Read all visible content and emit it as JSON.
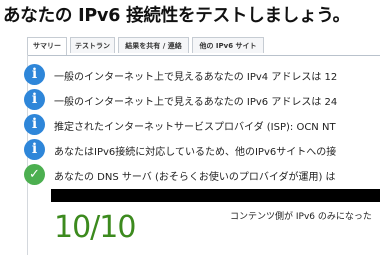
{
  "page": {
    "title": "あなたの IPv6 接続性をテストしましょう。"
  },
  "tabs": [
    {
      "label": "サマリー",
      "active": true
    },
    {
      "label": "テストラン",
      "active": false
    },
    {
      "label": "結果を共有 / 連絡",
      "active": false
    },
    {
      "label": "他の IPv6 サイト",
      "active": false
    }
  ],
  "results": [
    {
      "icon": "info-icon",
      "text": "一般のインターネット上で見えるあなたの IPv4 アドレスは 12"
    },
    {
      "icon": "info-icon",
      "text": "一般のインターネット上で見えるあなたの IPv6 アドレスは 24"
    },
    {
      "icon": "info-icon",
      "text": "推定されたインターネットサービスプロバイダ (ISP): OCN NT"
    },
    {
      "icon": "info-icon",
      "text": "あなたはIPv6接続に対応しているため、他のIPv6サイトへの接"
    },
    {
      "icon": "check-icon",
      "text": "あなたの DNS サーバ (おそらくお使いのプロバイダが運用) は"
    }
  ],
  "score": {
    "value": "10/10",
    "note": "コンテンツ側が IPv6 のみになった"
  },
  "colors": {
    "info": "#2e86d9",
    "ok": "#4caf50",
    "score": "#3c8a1e"
  }
}
